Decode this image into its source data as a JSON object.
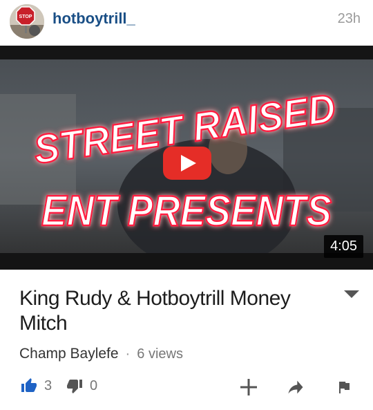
{
  "post": {
    "username": "hotboytrill_",
    "timestamp": "23h",
    "avatar_icon": "stop-sign-avatar-icon"
  },
  "video": {
    "overlay_lines": [
      "STREET RAISED",
      "ENT PRESENTS"
    ],
    "duration": "4:05",
    "play_icon": "play-icon",
    "play_color": "#e52d27"
  },
  "details": {
    "title": "King Rudy & Hotboytrill Money Mitch",
    "channel": "Champ Baylefe",
    "separator": "·",
    "views": "6 views",
    "likes": "3",
    "dislikes": "0"
  },
  "actions": {
    "like_icon": "thumbs-up-icon",
    "dislike_icon": "thumbs-down-icon",
    "add_icon": "plus-icon",
    "share_icon": "share-arrow-icon",
    "report_icon": "flag-icon",
    "like_color": "#1f63c5"
  }
}
